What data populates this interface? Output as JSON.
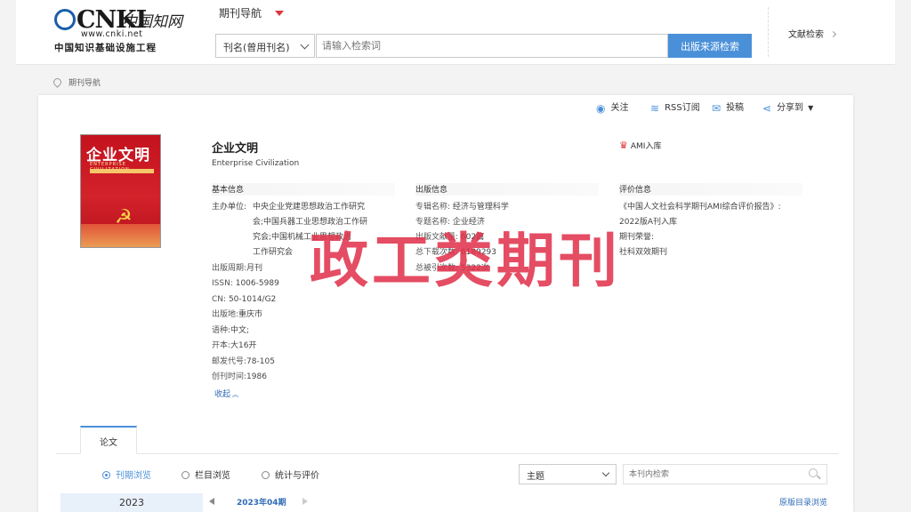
{
  "logo": {
    "brand": "CNKI",
    "cn_name": "中国知网",
    "url": "www.cnki.net",
    "subtitle": "中国知识基础设施工程"
  },
  "header": {
    "nav_title": "期刊导航",
    "search_field_selected": "刊名(曾用刊名)",
    "search_placeholder": "请输入检索词",
    "search_button": "出版来源检索",
    "advanced_search": "文献检索"
  },
  "breadcrumb": "期刊导航",
  "actions": {
    "follow": "关注",
    "rss": "RSS订阅",
    "submit": "投稿",
    "share": "分享到"
  },
  "journal": {
    "cover_title": "企业文明",
    "cover_en": "ENTERPRISE CIVILIZATION",
    "title": "企业文明",
    "title_en": "Enterprise Civilization",
    "ami_badge": "AMI入库"
  },
  "basic_info": {
    "heading": "基本信息",
    "sponsor_label": "主办单位:",
    "sponsor_lines": [
      "中央企业党建思想政治工作研究",
      "会;中国兵器工业思想政治工作研",
      "究会;中国机械工业思想政治",
      "工作研究会"
    ],
    "rows": [
      {
        "k": "出版周期:",
        "v": "月刊"
      },
      {
        "k": "ISSN:",
        "v": "1006-5989"
      },
      {
        "k": "CN:",
        "v": "50-1014/G2"
      },
      {
        "k": "出版地:",
        "v": "重庆市"
      },
      {
        "k": "语种:",
        "v": "中文;"
      },
      {
        "k": "开本:",
        "v": "大16开"
      },
      {
        "k": "邮发代号:",
        "v": "78-105"
      },
      {
        "k": "创刊时间:",
        "v": "1986"
      }
    ],
    "collapse": "收起"
  },
  "publish_info": {
    "heading": "出版信息",
    "rows": [
      {
        "k": "专辑名称:",
        "v": "经济与管理科学"
      },
      {
        "k": "专题名称:",
        "v": "企业经济"
      },
      {
        "k": "出版文献量:",
        "v": "602篇"
      },
      {
        "k": "总下载次数:",
        "v": "6189293"
      },
      {
        "k": "总被引次数:",
        "v": "5322次"
      }
    ]
  },
  "eval_info": {
    "heading": "评价信息",
    "lines": [
      "《中国人文社会科学期刊AMI综合评价报告》:",
      "2022版A刊入库",
      "期刊荣誉:",
      "社科双效期刊"
    ]
  },
  "watermark": "政工类期刊",
  "tabs": {
    "papers": "论文"
  },
  "browse": {
    "by_issue": "刊期浏览",
    "by_column": "栏目浏览",
    "stats": "统计与评价",
    "topic_select": "主题",
    "inner_search_placeholder": "本刊内检索"
  },
  "issues": {
    "year": "2023",
    "current_issue": "2023年04期",
    "catalog_link": "原版目录浏览"
  },
  "colors": {
    "accent": "#4a90d9",
    "link": "#2f6bb5",
    "watermark": "#e0314a",
    "nav_caret": "#d9363e"
  }
}
